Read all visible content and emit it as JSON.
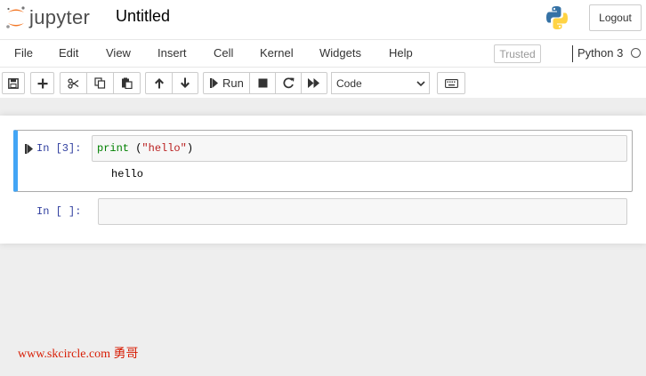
{
  "header": {
    "logo_text": "jupyter",
    "notebook_title": "Untitled",
    "logout_label": "Logout"
  },
  "menubar": {
    "items": [
      "File",
      "Edit",
      "View",
      "Insert",
      "Cell",
      "Kernel",
      "Widgets",
      "Help"
    ],
    "trusted_label": "Trusted",
    "kernel_name": "Python 3"
  },
  "toolbar": {
    "run_label": "Run",
    "cell_type": "Code"
  },
  "cells": [
    {
      "prompt": "In [3]:",
      "code_builtin": "print",
      "code_rest_open": " (",
      "code_string": "\"hello\"",
      "code_rest_close": ")",
      "output": "hello"
    },
    {
      "prompt": "In [ ]:",
      "code": ""
    }
  ],
  "watermark": "www.skcircle.com 勇哥",
  "colors": {
    "selected_cell_border": "#42a5f5",
    "prompt_color": "#303f9f",
    "logo_orange": "#f37726",
    "watermark": "#d81e06"
  }
}
